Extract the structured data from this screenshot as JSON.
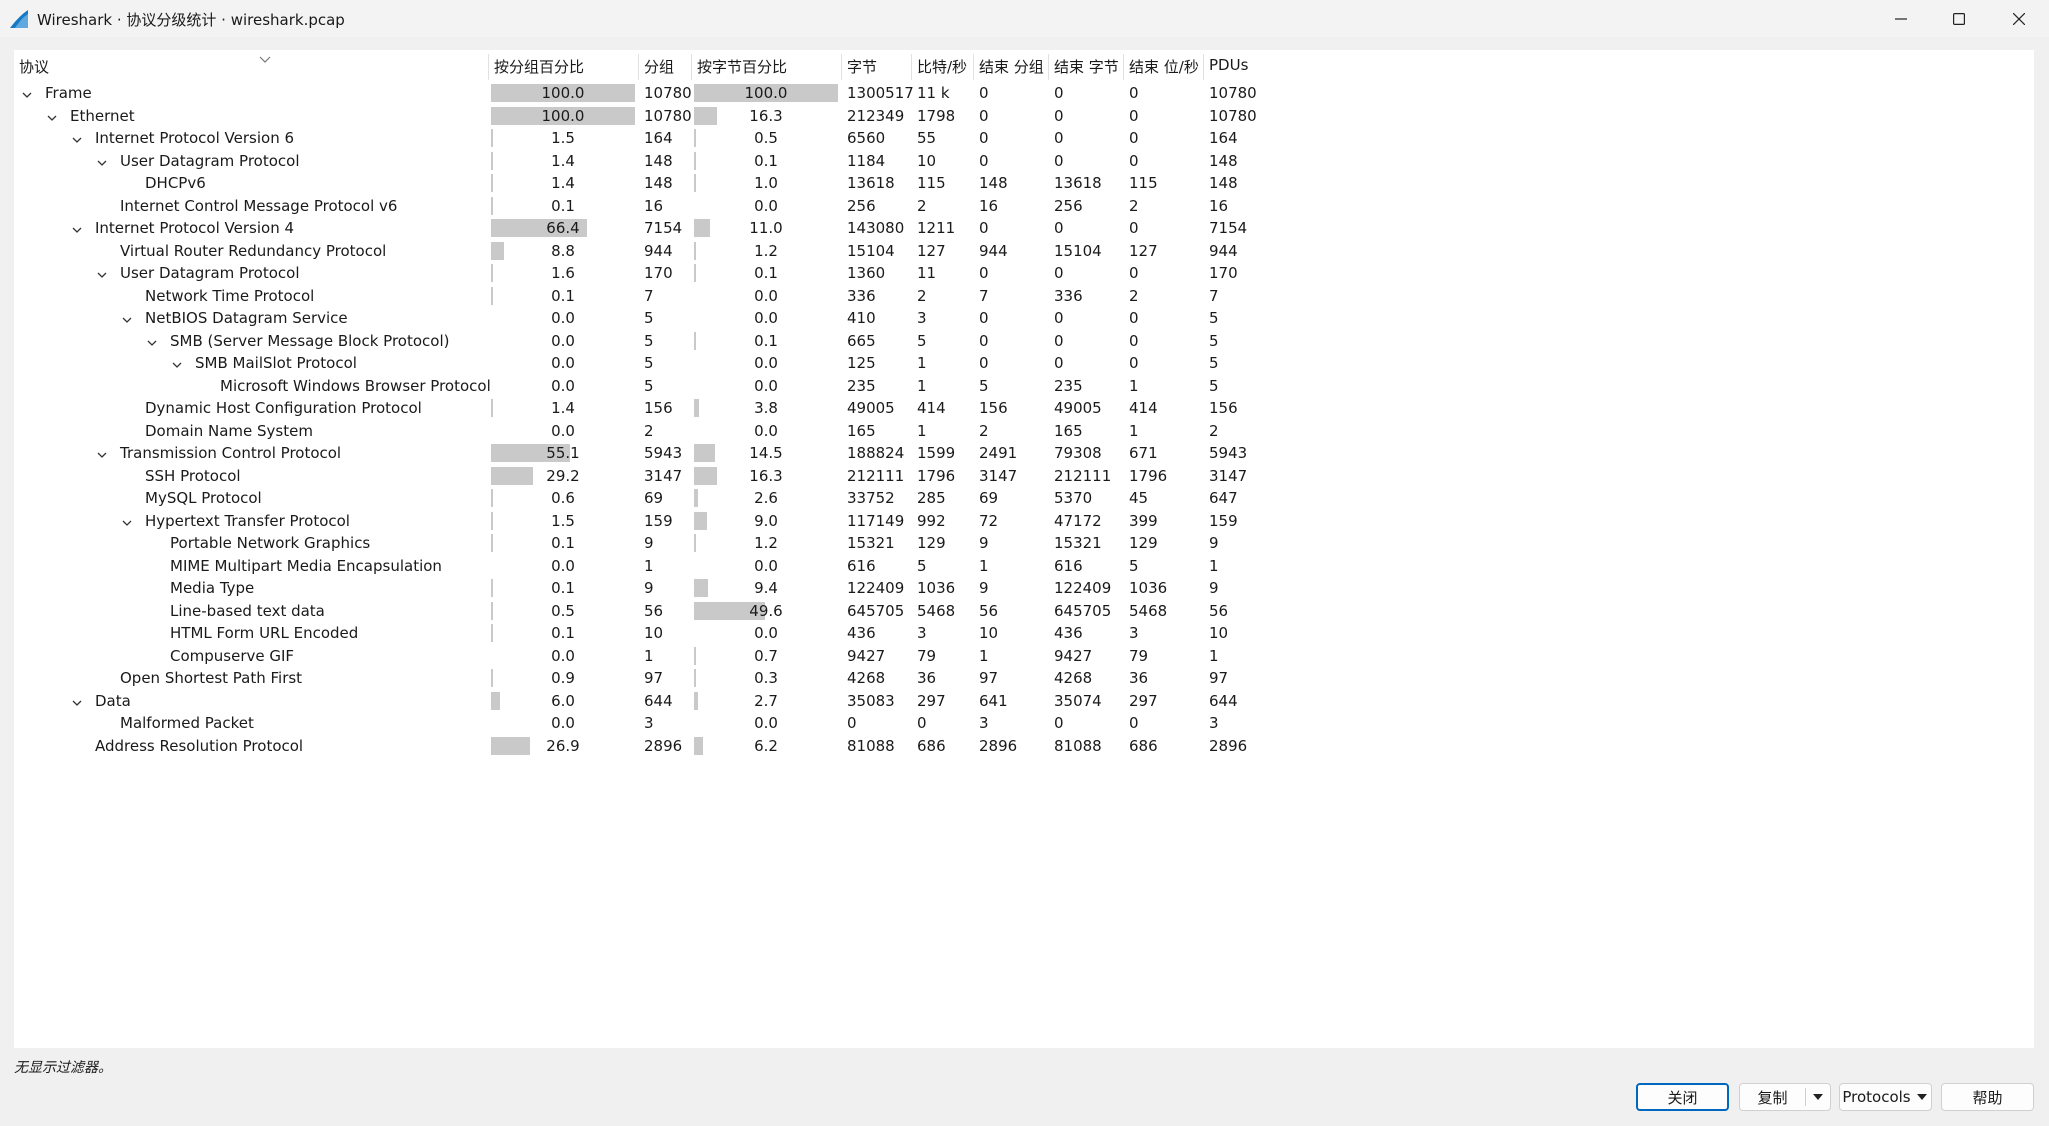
{
  "window": {
    "title": "Wireshark · 协议分级统计 · wireshark.pcap",
    "minimize_icon": "minimize-icon",
    "maximize_icon": "maximize-icon",
    "close_icon": "close-icon",
    "app_icon": "wireshark-fin-icon"
  },
  "colors": {
    "accent": "#0067c0",
    "bar": "#c9c9c9",
    "app_icon": "#1679c3"
  },
  "columns": [
    "协议",
    "按分组百分比",
    "分组",
    "按字节百分比",
    "字节",
    "比特/秒",
    "结束 分组",
    "结束 字节",
    "结束 位/秒",
    "PDUs"
  ],
  "rows": [
    {
      "name": "Frame",
      "level": 0,
      "expanded": true,
      "pkt_pct": "100.0",
      "pkts": "10780",
      "byte_pct": "100.0",
      "bytes": "1300517",
      "bps": "11 k",
      "end_pkts": "0",
      "end_bytes": "0",
      "end_bps": "0",
      "pdus": "10780"
    },
    {
      "name": "Ethernet",
      "level": 1,
      "expanded": true,
      "pkt_pct": "100.0",
      "pkts": "10780",
      "byte_pct": "16.3",
      "bytes": "212349",
      "bps": "1798",
      "end_pkts": "0",
      "end_bytes": "0",
      "end_bps": "0",
      "pdus": "10780"
    },
    {
      "name": "Internet Protocol Version 6",
      "level": 2,
      "expanded": true,
      "pkt_pct": "1.5",
      "pkts": "164",
      "byte_pct": "0.5",
      "bytes": "6560",
      "bps": "55",
      "end_pkts": "0",
      "end_bytes": "0",
      "end_bps": "0",
      "pdus": "164"
    },
    {
      "name": "User Datagram Protocol",
      "level": 3,
      "expanded": true,
      "pkt_pct": "1.4",
      "pkts": "148",
      "byte_pct": "0.1",
      "bytes": "1184",
      "bps": "10",
      "end_pkts": "0",
      "end_bytes": "0",
      "end_bps": "0",
      "pdus": "148"
    },
    {
      "name": "DHCPv6",
      "level": 4,
      "expanded": null,
      "pkt_pct": "1.4",
      "pkts": "148",
      "byte_pct": "1.0",
      "bytes": "13618",
      "bps": "115",
      "end_pkts": "148",
      "end_bytes": "13618",
      "end_bps": "115",
      "pdus": "148"
    },
    {
      "name": "Internet Control Message Protocol v6",
      "level": 3,
      "expanded": null,
      "pkt_pct": "0.1",
      "pkts": "16",
      "byte_pct": "0.0",
      "bytes": "256",
      "bps": "2",
      "end_pkts": "16",
      "end_bytes": "256",
      "end_bps": "2",
      "pdus": "16"
    },
    {
      "name": "Internet Protocol Version 4",
      "level": 2,
      "expanded": true,
      "pkt_pct": "66.4",
      "pkts": "7154",
      "byte_pct": "11.0",
      "bytes": "143080",
      "bps": "1211",
      "end_pkts": "0",
      "end_bytes": "0",
      "end_bps": "0",
      "pdus": "7154"
    },
    {
      "name": "Virtual Router Redundancy Protocol",
      "level": 3,
      "expanded": null,
      "pkt_pct": "8.8",
      "pkts": "944",
      "byte_pct": "1.2",
      "bytes": "15104",
      "bps": "127",
      "end_pkts": "944",
      "end_bytes": "15104",
      "end_bps": "127",
      "pdus": "944"
    },
    {
      "name": "User Datagram Protocol",
      "level": 3,
      "expanded": true,
      "pkt_pct": "1.6",
      "pkts": "170",
      "byte_pct": "0.1",
      "bytes": "1360",
      "bps": "11",
      "end_pkts": "0",
      "end_bytes": "0",
      "end_bps": "0",
      "pdus": "170"
    },
    {
      "name": "Network Time Protocol",
      "level": 4,
      "expanded": null,
      "pkt_pct": "0.1",
      "pkts": "7",
      "byte_pct": "0.0",
      "bytes": "336",
      "bps": "2",
      "end_pkts": "7",
      "end_bytes": "336",
      "end_bps": "2",
      "pdus": "7"
    },
    {
      "name": "NetBIOS Datagram Service",
      "level": 4,
      "expanded": true,
      "pkt_pct": "0.0",
      "pkts": "5",
      "byte_pct": "0.0",
      "bytes": "410",
      "bps": "3",
      "end_pkts": "0",
      "end_bytes": "0",
      "end_bps": "0",
      "pdus": "5"
    },
    {
      "name": "SMB (Server Message Block Protocol)",
      "level": 5,
      "expanded": true,
      "pkt_pct": "0.0",
      "pkts": "5",
      "byte_pct": "0.1",
      "bytes": "665",
      "bps": "5",
      "end_pkts": "0",
      "end_bytes": "0",
      "end_bps": "0",
      "pdus": "5"
    },
    {
      "name": "SMB MailSlot Protocol",
      "level": 6,
      "expanded": true,
      "pkt_pct": "0.0",
      "pkts": "5",
      "byte_pct": "0.0",
      "bytes": "125",
      "bps": "1",
      "end_pkts": "0",
      "end_bytes": "0",
      "end_bps": "0",
      "pdus": "5"
    },
    {
      "name": "Microsoft Windows Browser Protocol",
      "level": 7,
      "expanded": null,
      "pkt_pct": "0.0",
      "pkts": "5",
      "byte_pct": "0.0",
      "bytes": "235",
      "bps": "1",
      "end_pkts": "5",
      "end_bytes": "235",
      "end_bps": "1",
      "pdus": "5"
    },
    {
      "name": "Dynamic Host Configuration Protocol",
      "level": 4,
      "expanded": null,
      "pkt_pct": "1.4",
      "pkts": "156",
      "byte_pct": "3.8",
      "bytes": "49005",
      "bps": "414",
      "end_pkts": "156",
      "end_bytes": "49005",
      "end_bps": "414",
      "pdus": "156"
    },
    {
      "name": "Domain Name System",
      "level": 4,
      "expanded": null,
      "pkt_pct": "0.0",
      "pkts": "2",
      "byte_pct": "0.0",
      "bytes": "165",
      "bps": "1",
      "end_pkts": "2",
      "end_bytes": "165",
      "end_bps": "1",
      "pdus": "2"
    },
    {
      "name": "Transmission Control Protocol",
      "level": 3,
      "expanded": true,
      "pkt_pct": "55.1",
      "pkts": "5943",
      "byte_pct": "14.5",
      "bytes": "188824",
      "bps": "1599",
      "end_pkts": "2491",
      "end_bytes": "79308",
      "end_bps": "671",
      "pdus": "5943"
    },
    {
      "name": "SSH Protocol",
      "level": 4,
      "expanded": null,
      "pkt_pct": "29.2",
      "pkts": "3147",
      "byte_pct": "16.3",
      "bytes": "212111",
      "bps": "1796",
      "end_pkts": "3147",
      "end_bytes": "212111",
      "end_bps": "1796",
      "pdus": "3147"
    },
    {
      "name": "MySQL Protocol",
      "level": 4,
      "expanded": null,
      "pkt_pct": "0.6",
      "pkts": "69",
      "byte_pct": "2.6",
      "bytes": "33752",
      "bps": "285",
      "end_pkts": "69",
      "end_bytes": "5370",
      "end_bps": "45",
      "pdus": "647"
    },
    {
      "name": "Hypertext Transfer Protocol",
      "level": 4,
      "expanded": true,
      "pkt_pct": "1.5",
      "pkts": "159",
      "byte_pct": "9.0",
      "bytes": "117149",
      "bps": "992",
      "end_pkts": "72",
      "end_bytes": "47172",
      "end_bps": "399",
      "pdus": "159"
    },
    {
      "name": "Portable Network Graphics",
      "level": 5,
      "expanded": null,
      "pkt_pct": "0.1",
      "pkts": "9",
      "byte_pct": "1.2",
      "bytes": "15321",
      "bps": "129",
      "end_pkts": "9",
      "end_bytes": "15321",
      "end_bps": "129",
      "pdus": "9"
    },
    {
      "name": "MIME Multipart Media Encapsulation",
      "level": 5,
      "expanded": null,
      "pkt_pct": "0.0",
      "pkts": "1",
      "byte_pct": "0.0",
      "bytes": "616",
      "bps": "5",
      "end_pkts": "1",
      "end_bytes": "616",
      "end_bps": "5",
      "pdus": "1"
    },
    {
      "name": "Media Type",
      "level": 5,
      "expanded": null,
      "pkt_pct": "0.1",
      "pkts": "9",
      "byte_pct": "9.4",
      "bytes": "122409",
      "bps": "1036",
      "end_pkts": "9",
      "end_bytes": "122409",
      "end_bps": "1036",
      "pdus": "9"
    },
    {
      "name": "Line-based text data",
      "level": 5,
      "expanded": null,
      "pkt_pct": "0.5",
      "pkts": "56",
      "byte_pct": "49.6",
      "bytes": "645705",
      "bps": "5468",
      "end_pkts": "56",
      "end_bytes": "645705",
      "end_bps": "5468",
      "pdus": "56"
    },
    {
      "name": "HTML Form URL Encoded",
      "level": 5,
      "expanded": null,
      "pkt_pct": "0.1",
      "pkts": "10",
      "byte_pct": "0.0",
      "bytes": "436",
      "bps": "3",
      "end_pkts": "10",
      "end_bytes": "436",
      "end_bps": "3",
      "pdus": "10"
    },
    {
      "name": "Compuserve GIF",
      "level": 5,
      "expanded": null,
      "pkt_pct": "0.0",
      "pkts": "1",
      "byte_pct": "0.7",
      "bytes": "9427",
      "bps": "79",
      "end_pkts": "1",
      "end_bytes": "9427",
      "end_bps": "79",
      "pdus": "1"
    },
    {
      "name": "Open Shortest Path First",
      "level": 3,
      "expanded": null,
      "pkt_pct": "0.9",
      "pkts": "97",
      "byte_pct": "0.3",
      "bytes": "4268",
      "bps": "36",
      "end_pkts": "97",
      "end_bytes": "4268",
      "end_bps": "36",
      "pdus": "97"
    },
    {
      "name": "Data",
      "level": 2,
      "expanded": true,
      "pkt_pct": "6.0",
      "pkts": "644",
      "byte_pct": "2.7",
      "bytes": "35083",
      "bps": "297",
      "end_pkts": "641",
      "end_bytes": "35074",
      "end_bps": "297",
      "pdus": "644"
    },
    {
      "name": "Malformed Packet",
      "level": 3,
      "expanded": null,
      "pkt_pct": "0.0",
      "pkts": "3",
      "byte_pct": "0.0",
      "bytes": "0",
      "bps": "0",
      "end_pkts": "3",
      "end_bytes": "0",
      "end_bps": "0",
      "pdus": "3"
    },
    {
      "name": "Address Resolution Protocol",
      "level": 2,
      "expanded": null,
      "pkt_pct": "26.9",
      "pkts": "2896",
      "byte_pct": "6.2",
      "bytes": "81088",
      "bps": "686",
      "end_pkts": "2896",
      "end_bytes": "81088",
      "end_bps": "686",
      "pdus": "2896"
    }
  ],
  "status": {
    "text": "无显示过滤器。"
  },
  "buttons": {
    "close_label": "关闭",
    "copy_label": "复制",
    "protocols_label": "Protocols",
    "help_label": "帮助",
    "dropdown_icon": "triangle-down-icon"
  }
}
